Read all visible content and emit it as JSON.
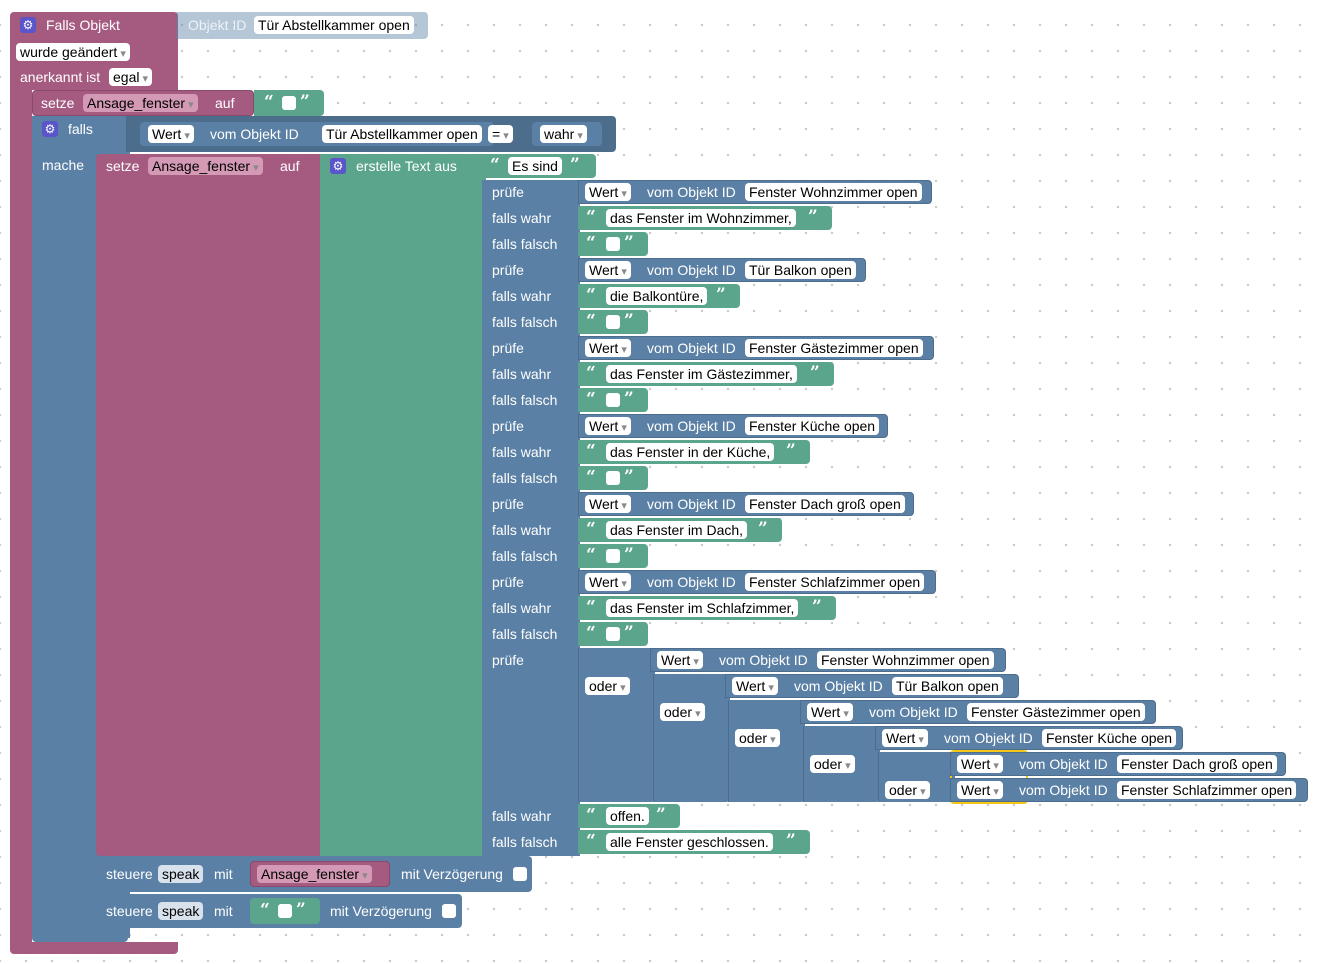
{
  "trigger": {
    "title": "Falls Objekt",
    "object_id_label": "Objekt ID",
    "object_id_value": "Tür Abstellkammer open",
    "changed": "wurde geändert",
    "ack_label": "anerkannt ist",
    "ack_value": "egal"
  },
  "set1": {
    "setze": "setze",
    "variable": "Ansage_fenster",
    "auf": "auf"
  },
  "if_block": {
    "falls": "falls",
    "mache": "mache",
    "wert": "Wert",
    "vom": "vom Objekt ID",
    "object": "Tür Abstellkammer open",
    "op": "=",
    "value": "wahr"
  },
  "set2": {
    "setze": "setze",
    "variable": "Ansage_fenster",
    "auf": "auf",
    "create_text": "erstelle Text aus",
    "first_text": "Es sind"
  },
  "labels": {
    "pruefe": "prüfe",
    "falls_wahr": "falls wahr",
    "falls_falsch": "falls falsch",
    "wert": "Wert",
    "vom": "vom Objekt ID",
    "oder": "oder"
  },
  "ternaries": [
    {
      "object": "Fenster Wohnzimmer open",
      "true_text": "das Fenster im Wohnzimmer,"
    },
    {
      "object": "Tür Balkon open",
      "true_text": "die Balkontüre,"
    },
    {
      "object": "Fenster Gästezimmer open",
      "true_text": "das Fenster im Gästezimmer,"
    },
    {
      "object": "Fenster Küche open",
      "true_text": "das Fenster in der Küche,"
    },
    {
      "object": "Fenster Dach groß open",
      "true_text": "das Fenster im Dach,"
    },
    {
      "object": "Fenster Schlafzimmer open",
      "true_text": "das Fenster im Schlafzimmer,"
    }
  ],
  "or_objects": [
    "Fenster Wohnzimmer open",
    "Tür Balkon open",
    "Fenster Gästezimmer open",
    "Fenster Küche open",
    "Fenster Dach groß open",
    "Fenster Schlafzimmer open"
  ],
  "final_ternary": {
    "true_text": "offen.",
    "false_text": "alle Fenster geschlossen."
  },
  "control1": {
    "steuere": "steuere",
    "target": "speak",
    "mit": "mit",
    "variable": "Ansage_fenster",
    "delay": "mit Verzögerung"
  },
  "control2": {
    "steuere": "steuere",
    "target": "speak",
    "mit": "mit",
    "delay": "mit Verzögerung"
  },
  "colors": {
    "event": "#a55b80",
    "logic": "#5b80a5",
    "text": "#5ba58c",
    "selection": "#f5c518"
  }
}
